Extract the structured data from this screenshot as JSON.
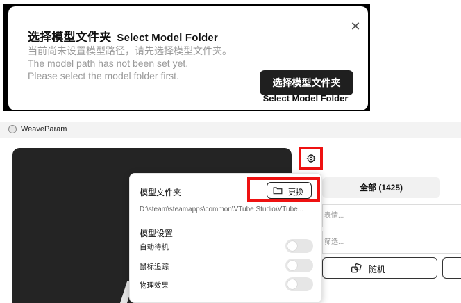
{
  "dialog": {
    "title_zh": "选择模型文件夹",
    "title_en": "Select Model Folder",
    "close_glyph": "✕",
    "desc_lines": [
      "当前尚未设置模型路径，请先选择模型文件夹。",
      "The model path has not been set yet.",
      "Please select the model folder first."
    ],
    "button_label": "选择模型文件夹",
    "button_caption": "Select Model Folder"
  },
  "window": {
    "title": "WeaveParam"
  },
  "settings_popup": {
    "model_folder_label": "模型文件夹",
    "change_button_label": "更换",
    "model_path": "D:\\steam\\steamapps\\common\\VTube Studio\\VTube...",
    "model_settings_label": "模型设置",
    "options": [
      {
        "label": "自动待机",
        "enabled": false
      },
      {
        "label": "鼠标追踪",
        "enabled": false
      },
      {
        "label": "物理效果",
        "enabled": false
      }
    ]
  },
  "right_panel": {
    "all_tab_label": "全部 (1425)",
    "search_placeholder": "表情...",
    "filter_placeholder": "筛选...",
    "random_button_label": "随机"
  },
  "icons": {
    "gear": "gear-icon",
    "folder": "folder-icon",
    "random": "random-icon",
    "app": "app-icon",
    "close": "close-icon"
  },
  "colors": {
    "highlight": "#ee1111",
    "dialog_button": "#1f1f1f",
    "preview_bg": "#242424"
  }
}
